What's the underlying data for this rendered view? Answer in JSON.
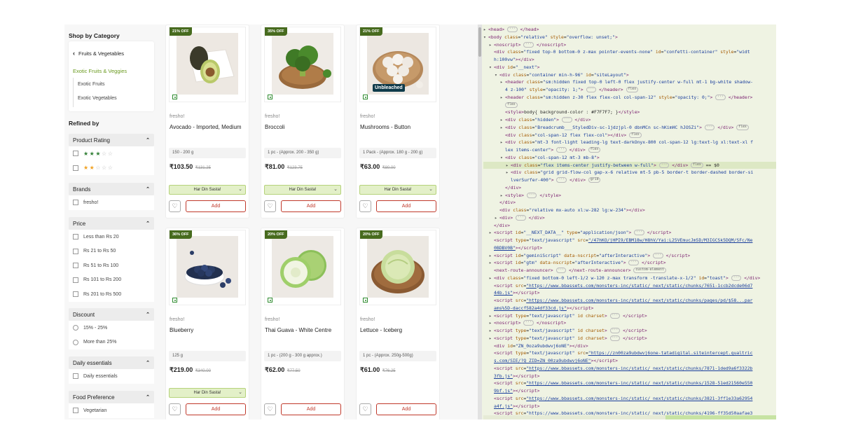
{
  "sidebar": {
    "shop_by_category": "Shop by Category",
    "category_back": "Fruits & Vegetables",
    "category_active": "Exotic Fruits & Veggies",
    "subcategories": [
      "Exotic Fruits",
      "Exotic Vegetables"
    ],
    "refined_by": "Refined by",
    "filters": {
      "rating": {
        "title": "Product Rating",
        "star_rows": [
          3,
          2
        ]
      },
      "brands": {
        "title": "Brands",
        "options": [
          "fresho!"
        ]
      },
      "price": {
        "title": "Price",
        "options": [
          "Less than Rs 20",
          "Rs 21 to Rs 50",
          "Rs 51 to Rs 100",
          "Rs 101 to Rs 200",
          "Rs 201 to Rs 500"
        ]
      },
      "discount": {
        "title": "Discount",
        "options": [
          "15% - 25%",
          "More than 25%"
        ]
      },
      "daily": {
        "title": "Daily essentials",
        "options": [
          "Daily essentials"
        ]
      },
      "food": {
        "title": "Food Preference",
        "options": [
          "Vegetarian"
        ]
      }
    }
  },
  "products": [
    {
      "discount": "21% OFF",
      "brand": "fresho!",
      "name": "Avocado - Imported, Medium",
      "pack": "150 - 200 g",
      "price": "₹103.50",
      "mrp": "₹131.25",
      "deal": "Har Din Sasta!",
      "add": "Add",
      "icon": "avocado"
    },
    {
      "discount": "35% OFF",
      "brand": "fresho!",
      "name": "Broccoli",
      "pack": "1 pc - (Approx. 200 - 350 g)",
      "price": "₹81.00",
      "mrp": "₹123.75",
      "deal": "Har Din Sasta!",
      "add": "Add",
      "icon": "broccoli"
    },
    {
      "discount": "21% OFF",
      "brand": "fresho!",
      "name": "Mushrooms - Button",
      "pack": "1 Pack - (Approx. 180 g - 200 g)",
      "price": "₹63.00",
      "mrp": "₹80.00",
      "deal": "Har Din Sasta!",
      "add": "Add",
      "icon": "mushroom",
      "label": "Unbleached"
    },
    {
      "discount": "36% OFF",
      "brand": "fresho!",
      "name": "Blueberry",
      "pack": "125 g",
      "price": "₹219.00",
      "mrp": "₹340.00",
      "deal": "Har Din Sasta!",
      "add": "Add",
      "icon": "blueberry"
    },
    {
      "discount": "20% OFF",
      "brand": "fresho!",
      "name": "Thai Guava - White Centre",
      "pack": "1 pc - (200 g - 300 g approx.)",
      "price": "₹62.00",
      "mrp": "₹77.50",
      "deal": "",
      "add": "Add",
      "icon": "guava"
    },
    {
      "discount": "20% OFF",
      "brand": "fresho!",
      "name": "Lettuce - Iceberg",
      "pack": "1 pc - (Approx. 250g-500g)",
      "price": "₹61.00",
      "mrp": "₹76.25",
      "deal": "",
      "add": "Add",
      "icon": "lettuce"
    }
  ],
  "devtools": {
    "lines": [
      {
        "i": 0,
        "t": "▸",
        "h": "<span class='tag'>&lt;head&gt;</span> <span class='pill'>···</span> <span class='tag'>&lt;/head&gt;</span>"
      },
      {
        "i": 0,
        "t": "▾",
        "h": "<span class='tag'>&lt;body</span> <span class='attr'>class</span>=<span class='val'>\"relative\"</span> <span class='attr'>style</span>=<span class='val'>\"overflow: unset;\"</span><span class='tag'>&gt;</span>"
      },
      {
        "i": 1,
        "t": "▸",
        "h": "<span class='tag'>&lt;noscript&gt;</span> <span class='pill'>···</span> <span class='tag'>&lt;/noscript&gt;</span>"
      },
      {
        "i": 1,
        "t": "",
        "h": "<span class='tag'>&lt;div</span> <span class='attr'>class</span>=<span class='val'>\"fixed top-0 bottom-0 z-max pointer-events-none\"</span> <span class='attr'>id</span>=<span class='val'>\"confetti-container\"</span> <span class='attr'>style</span>=<span class='val'>\"widt</span>"
      },
      {
        "i": 1,
        "t": "",
        "h": "<span class='val'>h:100vw\"</span><span class='tag'>&gt;&lt;/div&gt;</span>"
      },
      {
        "i": 1,
        "t": "▾",
        "h": "<span class='tag'>&lt;div</span> <span class='attr'>id</span>=<span class='val'>\"__next\"</span><span class='tag'>&gt;</span>"
      },
      {
        "i": 2,
        "t": "▾",
        "h": "<span class='tag'>&lt;div</span> <span class='attr'>class</span>=<span class='val'>\"container min-h-96\"</span> <span class='attr'>id</span>=<span class='val'>\"siteLayout\"</span><span class='tag'>&gt;</span>"
      },
      {
        "i": 3,
        "t": "▸",
        "h": "<span class='tag'>&lt;header</span> <span class='attr'>class</span>=<span class='val'>\"sm:hidden fixed top-0 left-0 flex justify-center w-full mt-1 bg-white shadow-</span>"
      },
      {
        "i": 3,
        "t": "",
        "h": "<span class='val'>4 z-100\"</span> <span class='attr'>style</span>=<span class='val'>\"opacity: 1;\"</span><span class='tag'>&gt;</span> <span class='pill'>···</span> <span class='tag'>&lt;/header&gt;</span> <span class='pill'>flex</span>"
      },
      {
        "i": 3,
        "t": "▸",
        "h": "<span class='tag'>&lt;header</span> <span class='attr'>class</span>=<span class='val'>\"sm:hidden z-30 flex flex-col col-span-12\"</span> <span class='attr'>style</span>=<span class='val'>\"opacity: 0;\"</span><span class='tag'>&gt;</span> <span class='pill'>···</span> <span class='tag'>&lt;/header&gt;</span>"
      },
      {
        "i": 3,
        "t": "",
        "h": "<span class='pill'>flex</span>"
      },
      {
        "i": 3,
        "t": "",
        "h": "<span class='tag'>&lt;style&gt;</span>body{ background-color : #F7F7F7; }<span class='tag'>&lt;/style&gt;</span>"
      },
      {
        "i": 3,
        "t": "▸",
        "h": "<span class='tag'>&lt;div</span> <span class='attr'>class</span>=<span class='val'>\"hidden\"</span><span class='tag'>&gt;</span> <span class='pill'>···</span> <span class='tag'>&lt;/div&gt;</span>"
      },
      {
        "i": 3,
        "t": "▸",
        "h": "<span class='tag'>&lt;div</span> <span class='attr'>class</span>=<span class='val'>\"Breadcrumb___StyledDiv-sc-1jdzjpl-0 dbnMCn sc-hKimHC hJOSZi\"</span><span class='tag'>&gt;</span> <span class='pill'>···</span> <span class='tag'>&lt;/div&gt;</span> <span class='pill'>flex</span>"
      },
      {
        "i": 3,
        "t": "",
        "h": "<span class='tag'>&lt;div</span> <span class='attr'>class</span>=<span class='val'>\"col-span-12 flex flex-col\"</span><span class='tag'>&gt;&lt;/div&gt;</span> <span class='pill'>flex</span>"
      },
      {
        "i": 3,
        "t": "▸",
        "h": "<span class='tag'>&lt;div</span> <span class='attr'>class</span>=<span class='val'>\"mt-3 font-light leading-lg text-darkOnyx-800 col-span-12 lg:text-lg xl:text-xl f</span>"
      },
      {
        "i": 3,
        "t": "",
        "h": "<span class='val'>lex items-center\"</span><span class='tag'>&gt;</span> <span class='pill'>···</span> <span class='tag'>&lt;/div&gt;</span> <span class='pill'>flex</span>"
      },
      {
        "i": 3,
        "t": "▾",
        "h": "<span class='tag'>&lt;div</span> <span class='attr'>class</span>=<span class='val'>\"col-span-12 mt-3 mb-8\"</span><span class='tag'>&gt;</span>"
      },
      {
        "i": 4,
        "t": "▸",
        "h": "<span class='tag'>&lt;div</span> <span class='attr'>class</span>=<span class='val'>\"flex items-center justify-between w-full\"</span><span class='tag'>&gt;</span> <span class='pill'>···</span> <span class='tag'>&lt;/div&gt;</span> <span class='pill'>flex</span> == $0",
        "sel": true
      },
      {
        "i": 4,
        "t": "▸",
        "h": "<span class='tag'>&lt;div</span> <span class='attr'>class</span>=<span class='val'>\"grid grid-flow-col gap-x-6 relative mt-5 pb-5 border-t border-dashed border-si</span>"
      },
      {
        "i": 4,
        "t": "",
        "h": "<span class='val'>lverSurfer-400\"</span><span class='tag'>&gt;</span> <span class='pill'>···</span> <span class='tag'>&lt;/div&gt;</span> <span class='pill'>grid</span>"
      },
      {
        "i": 3,
        "t": "",
        "h": "<span class='tag'>&lt;/div&gt;</span>"
      },
      {
        "i": 3,
        "t": "▸",
        "h": "<span class='tag'>&lt;style&gt;</span> <span class='pill'>···</span> <span class='tag'>&lt;/style&gt;</span>"
      },
      {
        "i": 2,
        "t": "",
        "h": "<span class='tag'>&lt;/div&gt;</span>"
      },
      {
        "i": 2,
        "t": "",
        "h": "<span class='tag'>&lt;div</span> <span class='attr'>class</span>=<span class='val'>\"relative mx-auto xl:w-282 lg:w-234\"</span><span class='tag'>&gt;&lt;/div&gt;</span>"
      },
      {
        "i": 2,
        "t": "▸",
        "h": "<span class='tag'>&lt;div&gt;</span> <span class='pill'>···</span> <span class='tag'>&lt;/div&gt;</span>"
      },
      {
        "i": 1,
        "t": "",
        "h": "<span class='tag'>&lt;/div&gt;</span>"
      },
      {
        "i": 1,
        "t": "▸",
        "h": "<span class='tag'>&lt;script</span> <span class='attr'>id</span>=<span class='val'>\"__NEXT_DATA__\"</span> <span class='attr'>type</span>=<span class='val'>\"application/json\"</span><span class='tag'>&gt;</span> <span class='pill'>···</span> <span class='tag'>&lt;/script&gt;</span>"
      },
      {
        "i": 1,
        "t": "",
        "h": "<span class='tag'>&lt;script</span> <span class='attr'>type</span>=<span class='val'>\"text/javascript\"</span> <span class='attr'>src</span>=<span class='url'>\"/47hKO/jHPI9/EBM18w/H8hV/Yai:L25VEmucJm5D/M3IGCSk5DQM/SFc/Ne</span>"
      },
      {
        "i": 1,
        "t": "",
        "h": "<span class='url'>0BDBV0B\"</span><span class='tag'>&gt;&lt;/script&gt;</span>"
      },
      {
        "i": 1,
        "t": "▸",
        "h": "<span class='tag'>&lt;script</span> <span class='attr'>id</span>=<span class='val'>\"geminiScript\"</span> <span class='attr'>data-nscript</span>=<span class='val'>\"afterInteractive\"</span><span class='tag'>&gt;</span> <span class='pill'>···</span> <span class='tag'>&lt;/script&gt;</span>"
      },
      {
        "i": 1,
        "t": "▸",
        "h": "<span class='tag'>&lt;script</span> <span class='attr'>id</span>=<span class='val'>\"gtm\"</span> <span class='attr'>data-nscript</span>=<span class='val'>\"afterInteractive\"</span><span class='tag'>&gt;</span> <span class='pill'>···</span> <span class='tag'>&lt;/script&gt;</span>"
      },
      {
        "i": 1,
        "t": "",
        "h": "<span class='tag'>&lt;next-route-announcer&gt;</span> <span class='pill'>···</span> <span class='tag'>&lt;/next-route-announcer&gt;</span> <span class='pill'>custom-element</span>"
      },
      {
        "i": 1,
        "t": "▸",
        "h": "<span class='tag'>&lt;div</span> <span class='attr'>class</span>=<span class='val'>\"fixed bottom-0 left-1/2 w-120 z-max transform -translate-x-1/2\"</span> <span class='attr'>id</span>=<span class='val'>\"toast\"</span><span class='tag'>&gt;</span> <span class='pill'>···</span> <span class='tag'>&lt;/div&gt;</span>"
      },
      {
        "i": 1,
        "t": "",
        "h": "<span class='tag'>&lt;script</span> <span class='attr'>src</span>=<span class='url'>\"https://www.bbassets.com/monsters-inc/static/_next/static/chunks/7651-1ccb2dcde06d7</span>"
      },
      {
        "i": 1,
        "t": "",
        "h": "<span class='url'>44b.js\"</span><span class='tag'>&gt;&lt;/script&gt;</span>"
      },
      {
        "i": 1,
        "t": "",
        "h": "<span class='tag'>&lt;script</span> <span class='attr'>src</span>=<span class='url'>\"https://www.bbassets.com/monsters-inc/static/_next/static/chunks/pages/pd/$58...par</span>"
      },
      {
        "i": 1,
        "t": "",
        "h": "<span class='url'>ams%5D-daccf582a4df33cd.js\"</span><span class='tag'>&gt;&lt;/script&gt;</span>"
      },
      {
        "i": 1,
        "t": "▸",
        "h": "<span class='tag'>&lt;script</span> <span class='attr'>type</span>=<span class='val'>\"text/javascript\"</span> <span class='attr'>id</span> <span class='attr'>charset</span><span class='tag'>&gt;</span> <span class='pill'>···</span> <span class='tag'>&lt;/script&gt;</span>"
      },
      {
        "i": 1,
        "t": "▸",
        "h": "<span class='tag'>&lt;noscript&gt;</span> <span class='pill'>···</span> <span class='tag'>&lt;/noscript&gt;</span>"
      },
      {
        "i": 1,
        "t": "▸",
        "h": "<span class='tag'>&lt;script</span> <span class='attr'>type</span>=<span class='val'>\"text/javascript\"</span> <span class='attr'>id</span> <span class='attr'>charset</span><span class='tag'>&gt;</span> <span class='pill'>···</span> <span class='tag'>&lt;/script&gt;</span>"
      },
      {
        "i": 1,
        "t": "▸",
        "h": "<span class='tag'>&lt;script</span> <span class='attr'>type</span>=<span class='val'>\"text/javascript\"</span> <span class='attr'>id</span> <span class='attr'>charset</span><span class='tag'>&gt;</span> <span class='pill'>···</span> <span class='tag'>&lt;/script&gt;</span>"
      },
      {
        "i": 1,
        "t": "",
        "h": "<span class='tag'>&lt;div</span> <span class='attr'>id</span>=<span class='val'>\"ZN_0oza9ubdwvj6oNE\"</span><span class='tag'>&gt;&lt;/div&gt;</span>"
      },
      {
        "i": 1,
        "t": "",
        "h": "<span class='tag'>&lt;script</span> <span class='attr'>type</span>=<span class='val'>\"text/javascript\"</span> <span class='attr'>src</span>=<span class='url'>\"https://zn00za9ubdwvj6one-tatadigital.siteintercept.qualtric</span>"
      },
      {
        "i": 1,
        "t": "",
        "h": "<span class='url'>s.com/SIE/?Q_ZID=ZN_00za9ubdwvj6oNE\"</span><span class='tag'>&gt;&lt;/script&gt;</span>"
      },
      {
        "i": 1,
        "t": "",
        "h": "<span class='tag'>&lt;script</span> <span class='attr'>src</span>=<span class='url'>\"https://www.bbassets.com/monsters-inc/static/_next/static/chunks/7871-1ded9a6f3322b</span>"
      },
      {
        "i": 1,
        "t": "",
        "h": "<span class='url'>3fb.js\"</span><span class='tag'>&gt;&lt;/script&gt;</span>"
      },
      {
        "i": 1,
        "t": "",
        "h": "<span class='tag'>&lt;script</span> <span class='attr'>src</span>=<span class='url'>\"https://www.bbassets.com/monsters-inc/static/_next/static/chunks/1528-51ed21560e550</span>"
      },
      {
        "i": 1,
        "t": "",
        "h": "<span class='url'>9bf.js\"</span><span class='tag'>&gt;&lt;/script&gt;</span>"
      },
      {
        "i": 1,
        "t": "",
        "h": "<span class='tag'>&lt;script</span> <span class='attr'>src</span>=<span class='url'>\"https://www.bbassets.com/monsters-inc/static/_next/static/chunks/3821-3ff1e33a62954</span>"
      },
      {
        "i": 1,
        "t": "",
        "h": "<span class='url'>a4f.js\"</span><span class='tag'>&gt;&lt;/script&gt;</span>"
      },
      {
        "i": 1,
        "t": "",
        "h": "<span class='tag'>&lt;script</span> <span class='attr'>src</span>=<span class='url'>\"https://www.bbassets.com/monsters-inc/static/_next/static/chunks/4196-ff35d50aafae3</span>"
      }
    ]
  }
}
